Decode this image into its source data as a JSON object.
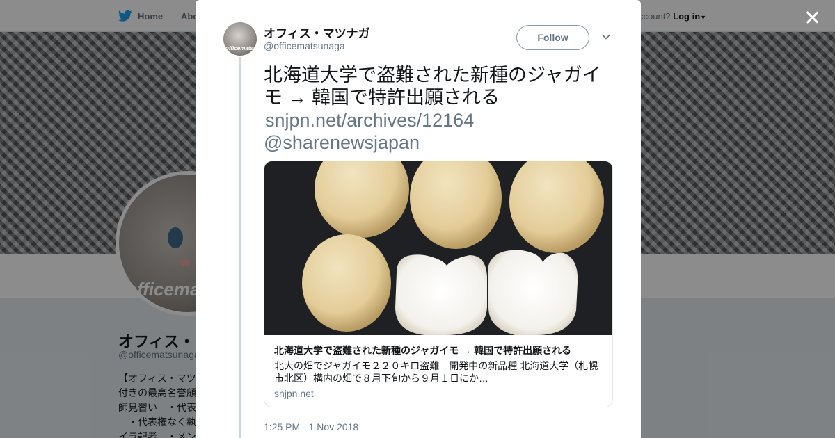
{
  "nav": {
    "home_label": "Home",
    "about_label": "Abo",
    "login_prompt": "ccount?",
    "login_label": "Log in"
  },
  "profile": {
    "avatar_watermark": "officemats",
    "name": "オフィス・",
    "handle": "@officematsunaga",
    "bio": "【オフィス・マツ\n付きの最高名誉顧\n師見習い　・代表\n　・代表権なく執\nイラ記者　・メン"
  },
  "tweet": {
    "author_name": "オフィス・マツナガ",
    "author_handle": "@officematsunaga",
    "avatar_watermark": "officematsunaga",
    "follow_label": "Follow",
    "text": "北海道大学で盗難された新種のジャガイモ → 韓国で特許出願される",
    "link": "snjpn.net/archives/12164",
    "mention": "@sharenewsjapan",
    "timestamp": "1:25 PM - 1 Nov 2018"
  },
  "card": {
    "title": "北海道大学で盗難された新種のジャガイモ → 韓国で特許出願される",
    "description": "北大の畑でジャガイモ２２０キロ盗難　開発中の新品種 北海道大学（札幌市北区）構内の畑で８月下旬から９月１日にか…",
    "domain": "snjpn.net"
  },
  "colors": {
    "brand_blue": "#1da1f2",
    "text_primary": "#14171a",
    "text_secondary": "#657786",
    "overlay": "rgba(0,0,0,0.45)"
  },
  "icons": {
    "nav_home": "twitter-bird-icon",
    "close": "close-icon",
    "caret": "chevron-down-icon"
  }
}
